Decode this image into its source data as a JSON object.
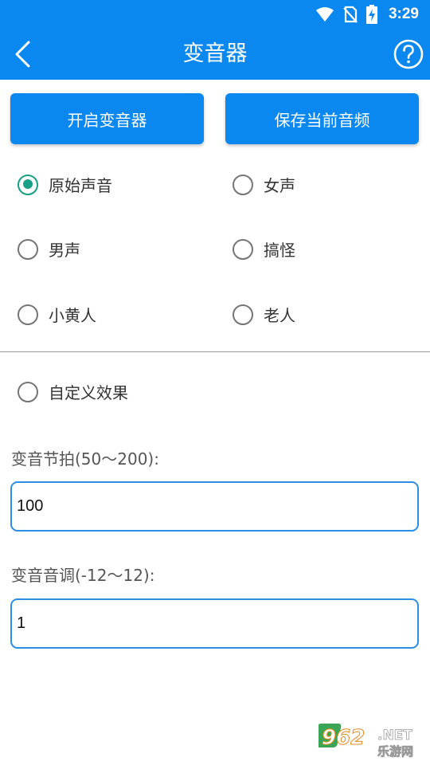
{
  "status_bar": {
    "time": "3:29"
  },
  "app_bar": {
    "title": "变音器"
  },
  "actions": {
    "start_label": "开启变音器",
    "save_label": "保存当前音频"
  },
  "voice_options": [
    {
      "label": "原始声音",
      "selected": true
    },
    {
      "label": "女声",
      "selected": false
    },
    {
      "label": "男声",
      "selected": false
    },
    {
      "label": "搞怪",
      "selected": false
    },
    {
      "label": "小黄人",
      "selected": false
    },
    {
      "label": "老人",
      "selected": false
    }
  ],
  "custom_option": {
    "label": "自定义效果",
    "selected": false
  },
  "tempo": {
    "label": "变音节拍(50～200):",
    "value": "100"
  },
  "pitch": {
    "label": "变音音调(-12～12):",
    "value": "1"
  },
  "watermark": {
    "number": "962",
    "suffix": ".NET",
    "sub": "乐游网"
  },
  "colors": {
    "primary": "#0a88f0",
    "radio_selected": "#16a085",
    "field_border": "#2b8fe6"
  }
}
